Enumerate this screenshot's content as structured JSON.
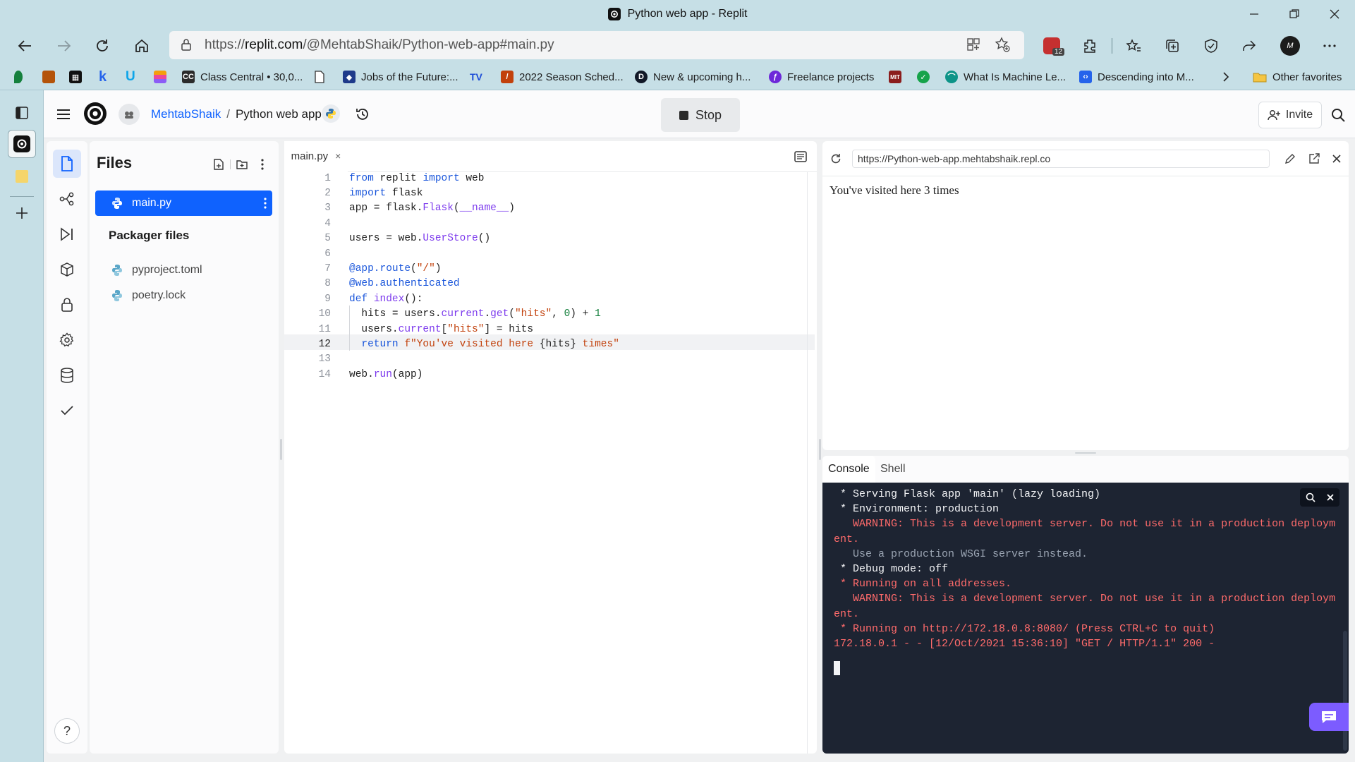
{
  "window": {
    "title": "Python web app - Replit"
  },
  "browser": {
    "url_prefix": "https://",
    "url_host": "replit.com",
    "url_path": "/@MehtabShaik/Python-web-app#main.py",
    "badge_count": "12",
    "bookmarks": [
      {
        "label": "Class Central • 30,0...",
        "color": "#2b2b2b"
      },
      {
        "label": "Jobs of the Future:...",
        "color": "#1e3a8a"
      },
      {
        "label": "2022 Season Sched...",
        "color": "#c2410c"
      },
      {
        "label": "New & upcoming h...",
        "color": "#111827"
      },
      {
        "label": "Freelance projects",
        "color": "#6d28d9"
      },
      {
        "label": "What Is Machine Le...",
        "color": "#0d9488"
      },
      {
        "label": "Descending into M...",
        "color": "#2563eb"
      }
    ],
    "other_favorites": "Other favorites"
  },
  "header": {
    "user": "MehtabShaik",
    "separator": "/",
    "project": "Python web app",
    "stop_label": "Stop",
    "invite_label": "Invite"
  },
  "files": {
    "title": "Files",
    "active_file": "main.py",
    "packager_title": "Packager files",
    "packager_items": [
      "pyproject.toml",
      "poetry.lock"
    ]
  },
  "editor": {
    "tab_label": "main.py",
    "close_glyph": "×",
    "line_numbers": [
      "1",
      "2",
      "3",
      "4",
      "5",
      "6",
      "7",
      "8",
      "9",
      "10",
      "11",
      "12",
      "13",
      "14"
    ]
  },
  "webview": {
    "url": "https://Python-web-app.mehtabshaik.repl.co",
    "content": "You've visited here 3 times"
  },
  "console": {
    "tabs": [
      "Console",
      "Shell"
    ],
    "lines": [
      {
        "text": " * Serving Flask app 'main' (lazy loading)",
        "kind": "w"
      },
      {
        "text": " * Environment: production",
        "kind": "w"
      },
      {
        "text": "   WARNING: This is a development server. Do not use it in a production deploym",
        "kind": "r"
      },
      {
        "text": "ent.",
        "kind": "r"
      },
      {
        "text": "   Use a production WSGI server instead.",
        "kind": "g"
      },
      {
        "text": " * Debug mode: off",
        "kind": "w"
      },
      {
        "text": " * Running on all addresses.",
        "kind": "r"
      },
      {
        "text": "   WARNING: This is a development server. Do not use it in a production deploym",
        "kind": "r"
      },
      {
        "text": "ent.",
        "kind": "r"
      },
      {
        "text": " * Running on http://172.18.0.8:8080/ (Press CTRL+C to quit)",
        "kind": "r"
      },
      {
        "text": "172.18.0.1 - - [12/Oct/2021 15:36:10] \"GET / HTTP/1.1\" 200 -",
        "kind": "r"
      }
    ]
  },
  "help_label": "?",
  "colors": {
    "accent": "#0f62fe",
    "browser_chrome": "#c6dfe6",
    "terminal_bg": "#1d2432",
    "chat_button": "#7c5cff"
  }
}
